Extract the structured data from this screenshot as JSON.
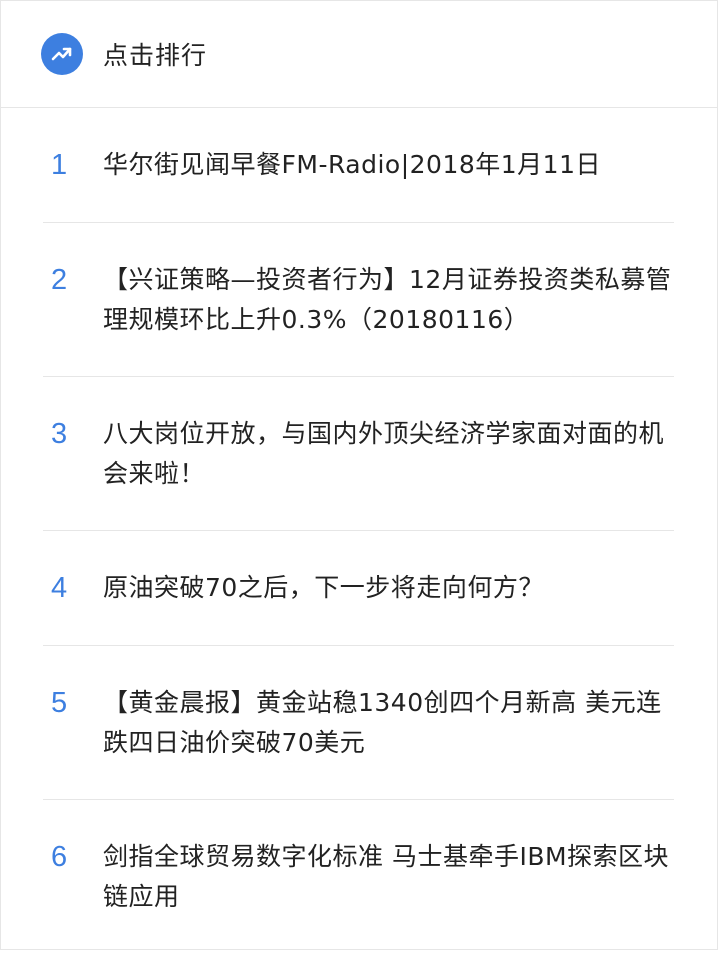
{
  "header": {
    "title": "点击排行",
    "icon": "trending-up-icon",
    "accent_color": "#3d7fe0"
  },
  "items": [
    {
      "rank": "1",
      "title": "华尔街见闻早餐FM-Radio|2018年1月11日"
    },
    {
      "rank": "2",
      "title": "【兴证策略—投资者行为】12月证券投资类私募管理规模环比上升0.3%（20180116）"
    },
    {
      "rank": "3",
      "title": "八大岗位开放，与国内外顶尖经济学家面对面的机会来啦！"
    },
    {
      "rank": "4",
      "title": "原油突破70之后，下一步将走向何方？"
    },
    {
      "rank": "5",
      "title": "【黄金晨报】黄金站稳1340创四个月新高 美元连跌四日油价突破70美元"
    },
    {
      "rank": "6",
      "title": "剑指全球贸易数字化标准 马士基牵手IBM探索区块链应用"
    }
  ]
}
